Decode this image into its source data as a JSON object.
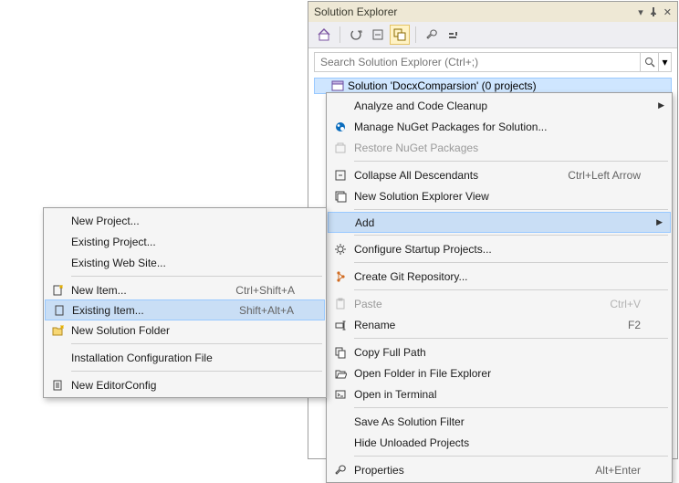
{
  "panel": {
    "title": "Solution Explorer"
  },
  "search": {
    "placeholder": "Search Solution Explorer (Ctrl+;)"
  },
  "tree": {
    "solution_label": "Solution 'DocxComparsion' (0 projects)"
  },
  "ctx1": {
    "analyze": "Analyze and Code Cleanup",
    "manage_nuget": "Manage NuGet Packages for Solution...",
    "restore_nuget": "Restore NuGet Packages",
    "collapse": "Collapse All Descendants",
    "collapse_sc": "Ctrl+Left Arrow",
    "new_view": "New Solution Explorer View",
    "add": "Add",
    "configure": "Configure Startup Projects...",
    "create_git": "Create Git Repository...",
    "paste": "Paste",
    "paste_sc": "Ctrl+V",
    "rename": "Rename",
    "rename_sc": "F2",
    "copy_path": "Copy Full Path",
    "open_folder": "Open Folder in File Explorer",
    "open_terminal": "Open in Terminal",
    "save_filter": "Save As Solution Filter",
    "hide_unloaded": "Hide Unloaded Projects",
    "properties": "Properties",
    "properties_sc": "Alt+Enter"
  },
  "ctx2": {
    "new_project": "New Project...",
    "existing_project": "Existing Project...",
    "existing_web": "Existing Web Site...",
    "new_item": "New Item...",
    "new_item_sc": "Ctrl+Shift+A",
    "existing_item": "Existing Item...",
    "existing_item_sc": "Shift+Alt+A",
    "new_folder": "New Solution Folder",
    "install_config": "Installation Configuration File",
    "new_editor": "New EditorConfig"
  }
}
